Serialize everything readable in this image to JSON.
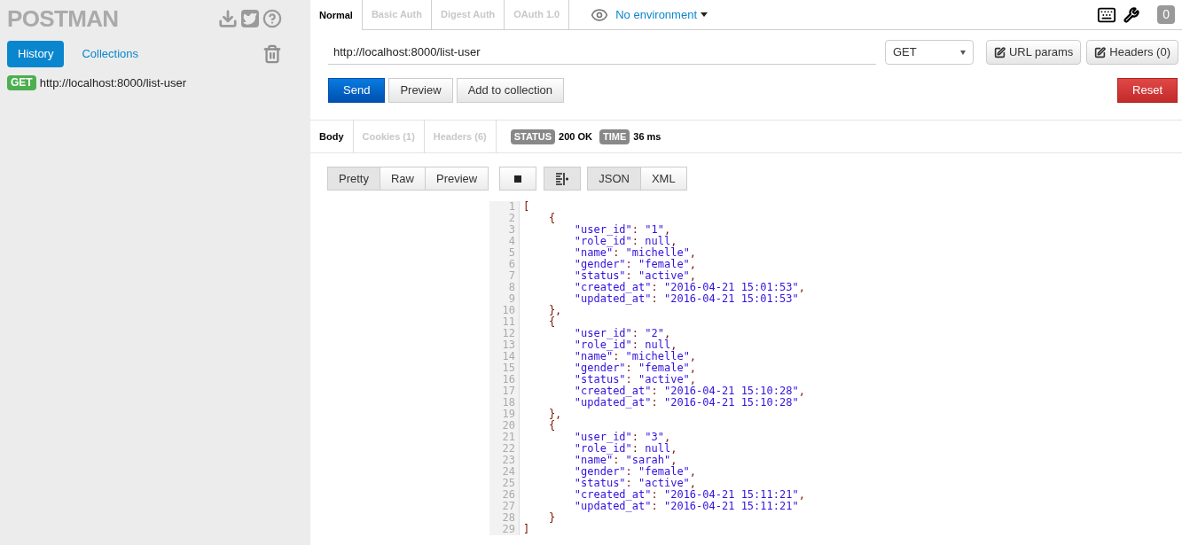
{
  "sidebar": {
    "logo": "POSTMAN",
    "tabs": [
      {
        "label": "History",
        "selected": true
      },
      {
        "label": "Collections",
        "selected": false
      }
    ],
    "history": [
      {
        "method": "GET",
        "url": "http://localhost:8000/list-user"
      }
    ]
  },
  "request_tabs": [
    {
      "label": "Normal",
      "selected": true
    },
    {
      "label": "Basic Auth",
      "selected": false
    },
    {
      "label": "Digest Auth",
      "selected": false
    },
    {
      "label": "OAuth 1.0",
      "selected": false
    }
  ],
  "environment": "No environment",
  "notification_count": "0",
  "url_field": {
    "value": "http://localhost:8000/list-user"
  },
  "method_select": "GET",
  "param_buttons": [
    "URL params",
    "Headers (0)"
  ],
  "action_buttons": [
    "Send",
    "Preview",
    "Add to collection"
  ],
  "reset_button": "Reset",
  "response_tabs": [
    {
      "label": "Body",
      "selected": true
    },
    {
      "label": "Cookies (1)",
      "selected": false
    },
    {
      "label": "Headers (6)",
      "selected": false
    }
  ],
  "status": {
    "label": "STATUS",
    "value": "200 OK"
  },
  "time": {
    "label": "TIME",
    "value": "36 ms"
  },
  "view_modes": [
    {
      "label": "Pretty",
      "selected": true
    },
    {
      "label": "Raw",
      "selected": false
    },
    {
      "label": "Preview",
      "selected": false
    }
  ],
  "wrap_toggle": {
    "on": true
  },
  "formats": [
    {
      "label": "JSON",
      "selected": true
    },
    {
      "label": "XML",
      "selected": false
    }
  ],
  "code_lines": [
    {
      "number": "1",
      "text": "["
    },
    {
      "number": "2",
      "text": "    {"
    },
    {
      "number": "3",
      "text": "        \"user_id\": \"1\","
    },
    {
      "number": "4",
      "text": "        \"role_id\": null,"
    },
    {
      "number": "5",
      "text": "        \"name\": \"michelle\","
    },
    {
      "number": "6",
      "text": "        \"gender\": \"female\","
    },
    {
      "number": "7",
      "text": "        \"status\": \"active\","
    },
    {
      "number": "8",
      "text": "        \"created_at\": \"2016-04-21 15:01:53\","
    },
    {
      "number": "9",
      "text": "        \"updated_at\": \"2016-04-21 15:01:53\""
    },
    {
      "number": "10",
      "text": "    },"
    },
    {
      "number": "11",
      "text": "    {"
    },
    {
      "number": "12",
      "text": "        \"user_id\": \"2\","
    },
    {
      "number": "13",
      "text": "        \"role_id\": null,"
    },
    {
      "number": "14",
      "text": "        \"name\": \"michelle\","
    },
    {
      "number": "15",
      "text": "        \"gender\": \"female\","
    },
    {
      "number": "16",
      "text": "        \"status\": \"active\","
    },
    {
      "number": "17",
      "text": "        \"created_at\": \"2016-04-21 15:10:28\","
    },
    {
      "number": "18",
      "text": "        \"updated_at\": \"2016-04-21 15:10:28\""
    },
    {
      "number": "19",
      "text": "    },"
    },
    {
      "number": "20",
      "text": "    {"
    },
    {
      "number": "21",
      "text": "        \"user_id\": \"3\","
    },
    {
      "number": "22",
      "text": "        \"role_id\": null,"
    },
    {
      "number": "23",
      "text": "        \"name\": \"sarah\","
    },
    {
      "number": "24",
      "text": "        \"gender\": \"female\","
    },
    {
      "number": "25",
      "text": "        \"status\": \"active\","
    },
    {
      "number": "26",
      "text": "        \"created_at\": \"2016-04-21 15:11:21\","
    },
    {
      "number": "27",
      "text": "        \"updated_at\": \"2016-04-21 15:11:21\""
    },
    {
      "number": "28",
      "text": "    }"
    },
    {
      "number": "29",
      "text": "]"
    }
  ]
}
